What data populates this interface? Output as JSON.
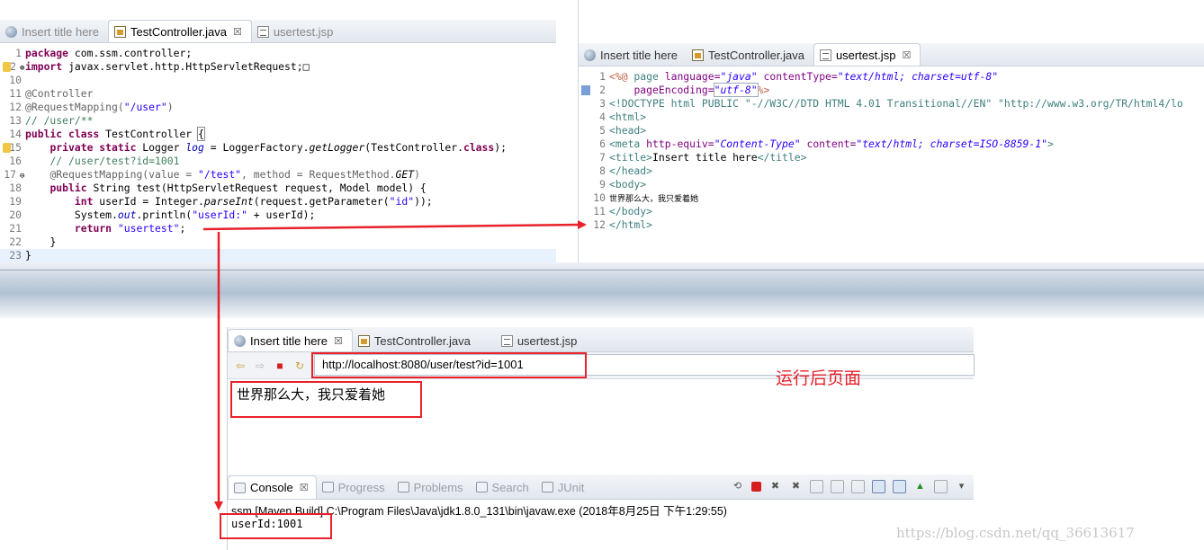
{
  "left_editor": {
    "tabs": [
      {
        "label": "Insert title here",
        "icon": "globe-icon"
      },
      {
        "label": "TestController.java",
        "icon": "java-file-icon",
        "close": "☒"
      },
      {
        "label": "usertest.jsp",
        "icon": "jsp-file-icon"
      }
    ],
    "line_numbers": [
      "1",
      "2",
      "10",
      "11",
      "12",
      "13",
      "14",
      "15",
      "16",
      "17",
      "18",
      "19",
      "20",
      "21",
      "22",
      "23"
    ],
    "code": {
      "l1_kw": "package",
      "l1_rest": " com.ssm.controller;",
      "l2_kw": "import",
      "l2_rest": " javax.servlet.http.HttpServletRequest;",
      "l2_fold": "⊕",
      "l2_box": "□",
      "l11": "@Controller",
      "l12_ann": "@RequestMapping(",
      "l12_str": "\"/user\"",
      "l12_end": ")",
      "l13": "// /user/**",
      "l14_kw": "public class",
      "l14_rest": " TestController ",
      "l14_brace": "{",
      "l15_kw": "private static",
      "l15_a": " Logger ",
      "l15_fld": "log",
      "l15_b": " = LoggerFactory.",
      "l15_it": "getLogger",
      "l15_c": "(TestController.",
      "l15_kw2": "class",
      "l15_d": ");",
      "l16": "// /user/test?id=1001",
      "l17_ann": "@RequestMapping(value = ",
      "l17_str": "\"/test\"",
      "l17_mid": ", method = RequestMethod.",
      "l17_it": "GET",
      "l17_end": ")",
      "l17_fold": "⊖",
      "l18_kw": "public",
      "l18_rest": " String test(HttpServletRequest request, Model model) {",
      "l19_kw": "int",
      "l19_a": " userId = Integer.",
      "l19_it": "parseInt",
      "l19_b": "(request.getParameter(",
      "l19_str": "\"id\"",
      "l19_c": "));",
      "l20_a": "System.",
      "l20_fld": "out",
      "l20_b": ".println(",
      "l20_str": "\"userId:\"",
      "l20_c": " + userId);",
      "l21_kw": "return",
      "l21_str": " \"usertest\"",
      "l21_end": ";",
      "l22": "}",
      "l23": "}"
    }
  },
  "right_editor": {
    "tabs": [
      {
        "label": "Insert title here",
        "icon": "globe-icon"
      },
      {
        "label": "TestController.java",
        "icon": "java-file-icon"
      },
      {
        "label": "usertest.jsp",
        "icon": "jsp-file-icon",
        "close": "☒"
      }
    ],
    "line_numbers": [
      "1",
      "2",
      "3",
      "4",
      "5",
      "6",
      "7",
      "8",
      "9",
      "10",
      "11",
      "12"
    ],
    "code": {
      "l1_open": "<%@",
      "l1_page": " page ",
      "l1_attr1": "language=",
      "l1_val1": "\"java\"",
      "l1_attr2": " contentType=",
      "l1_val2": "\"text/html; charset=utf-8\"",
      "l2_attr": "pageEncoding=",
      "l2_val": "\"utf-8\"",
      "l2_close": "%>",
      "l3": "<!DOCTYPE html PUBLIC \"-//W3C//DTD HTML 4.01 Transitional//EN\" \"http://www.w3.org/TR/html4/lo",
      "l4": "<html>",
      "l5": "<head>",
      "l6_tag": "<meta ",
      "l6_attr1": "http-equiv=",
      "l6_val1": "\"Content-Type\"",
      "l6_attr2": " content=",
      "l6_val2": "\"text/html; charset=ISO-8859-1\"",
      "l6_end": ">",
      "l7_open": "<title>",
      "l7_text": "Insert title here",
      "l7_close": "</title>",
      "l8": "</head>",
      "l9": "<body>",
      "l10": "世界那么大，我只爱着她",
      "l11": "</body>",
      "l12": "</html>"
    }
  },
  "browser": {
    "tabs": [
      {
        "label": "Insert title here",
        "icon": "globe-icon",
        "close": "☒"
      },
      {
        "label": "TestController.java",
        "icon": "java-file-icon"
      },
      {
        "label": "usertest.jsp",
        "icon": "jsp-file-icon"
      }
    ],
    "nav": {
      "back": "⇦",
      "forward": "⇨",
      "stop": "■",
      "refresh": "↻"
    },
    "url": "http://localhost:8080/user/test?id=1001",
    "page_text": "世界那么大，我只爱着她"
  },
  "annotation_label": "运行后页面",
  "console": {
    "tabs": [
      {
        "label": "Console",
        "close": "☒"
      },
      {
        "label": "Progress"
      },
      {
        "label": "Problems"
      },
      {
        "label": "Search"
      },
      {
        "label": "JUnit"
      }
    ],
    "header": "ssm [Maven Build] C:\\Program Files\\Java\\jdk1.8.0_131\\bin\\javaw.exe (2018年8月25日 下午1:29:55)",
    "output": "userId:1001"
  },
  "watermark": "https://blog.csdn.net/qq_36613617",
  "colors": {
    "annotation_red": "#e8212a",
    "keyword": "#7f0055",
    "string": "#2a00ff",
    "comment": "#3f7f5f"
  }
}
